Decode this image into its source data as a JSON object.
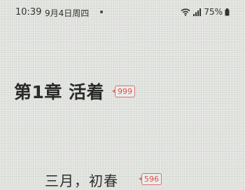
{
  "status_bar": {
    "time": "10:39",
    "date": "9月4日周四",
    "battery": "75%",
    "icons": [
      "wifi-icon",
      "signal-icon",
      "battery-icon"
    ]
  },
  "content": {
    "chapter_title": "第1章 活着",
    "chapter_comment_count": "999",
    "paragraph_text": "三月，初春",
    "paragraph_comment_count": "596"
  },
  "colors": {
    "page_background": "#dfe1dd",
    "text": "#2a2a2a",
    "comment_badge": "#d9534f"
  }
}
